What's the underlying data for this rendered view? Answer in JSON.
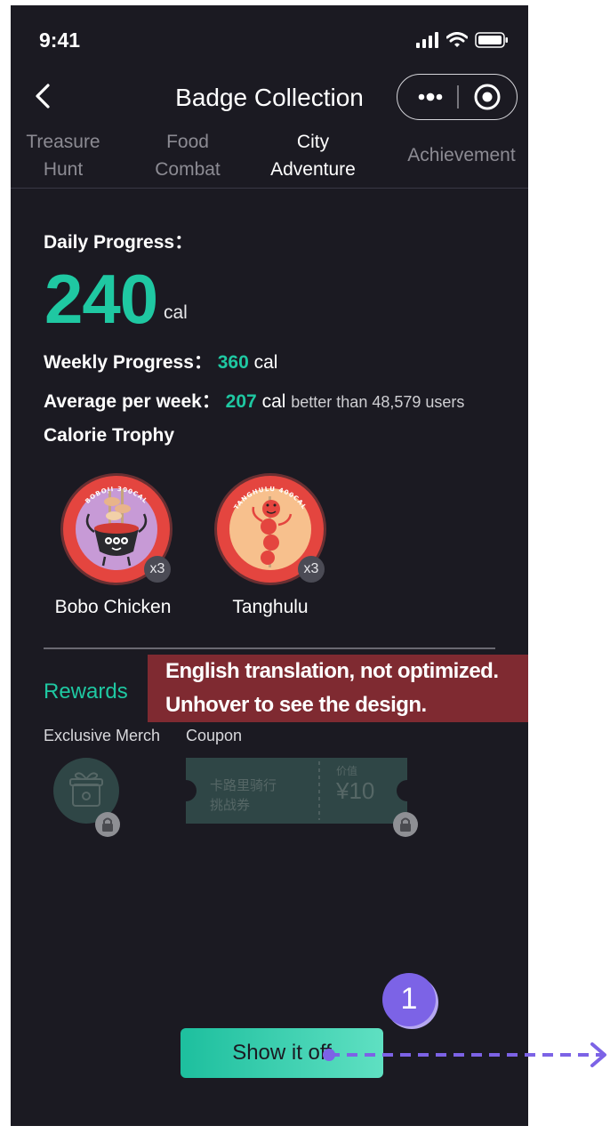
{
  "status_bar": {
    "time": "9:41"
  },
  "nav": {
    "title": "Badge Collection"
  },
  "tabs": [
    {
      "line1": "Treasure",
      "line2": "Hunt"
    },
    {
      "line1": "Food",
      "line2": "Combat"
    },
    {
      "line1": "City",
      "line2": "Adventure",
      "active": true
    },
    {
      "line1": "Achievement",
      "line2": ""
    }
  ],
  "daily": {
    "label": "Daily Progress：",
    "value": "240",
    "unit": "cal"
  },
  "weekly": {
    "label": "Weekly Progress：",
    "value": "360",
    "unit": "cal"
  },
  "average": {
    "label": "Average per week：",
    "value": "207",
    "unit": "cal",
    "note": "better than 48,579 users"
  },
  "trophy": {
    "title": "Calorie Trophy",
    "badges": [
      {
        "name": "Bobo Chicken",
        "count": "x3",
        "ring_top": "BOBOJI 300CAL",
        "ring_side": "300CAL BOBOJI"
      },
      {
        "name": "Tanghulu",
        "count": "x3",
        "ring_top": "TANGHULU 400CAL",
        "ring_side": "400CAL TANGHULU"
      }
    ]
  },
  "rewards": {
    "title": "Rewards",
    "merch_label": "Exclusive Merch",
    "coupon_label": "Coupon",
    "coupon": {
      "line1": "卡路里骑行",
      "line2": "挑战券",
      "value_label": "价值",
      "value": "¥10"
    }
  },
  "overlay": {
    "line1": "English translation, not optimized.",
    "line2": "Unhover to see the design."
  },
  "button": {
    "label": "Show it off"
  },
  "annotation": {
    "marker": "1"
  },
  "colors": {
    "accent": "#1fc8a2",
    "background": "#1b1a22",
    "overlay": "#7f2a31",
    "annotation": "#7c63e6"
  }
}
